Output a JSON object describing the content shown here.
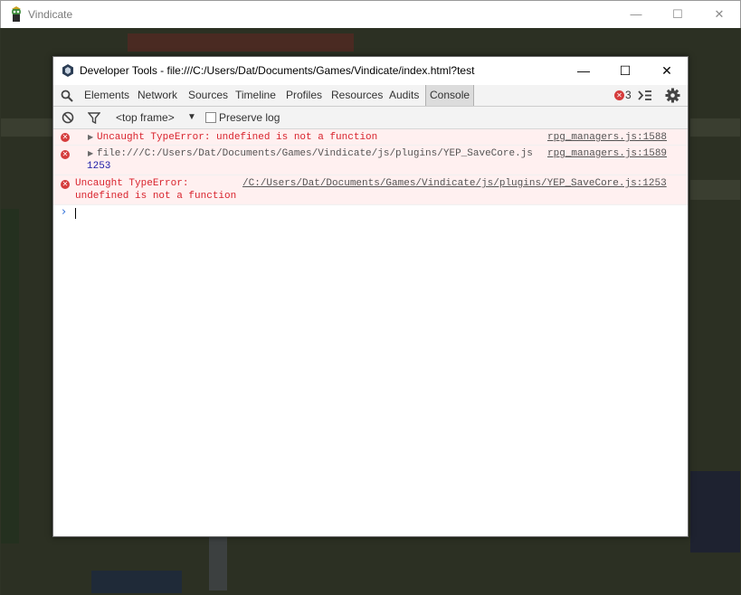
{
  "outer_window": {
    "title": "Vindicate",
    "minimize": "—",
    "maximize": "☐",
    "close": "✕"
  },
  "devtools": {
    "title": "Developer Tools - file:///C:/Users/Dat/Documents/Games/Vindicate/index.html?test",
    "controls": {
      "minimize": "—",
      "maximize": "☐",
      "close": "✕"
    },
    "tabs": [
      "Elements",
      "Network",
      "Sources",
      "Timeline",
      "Profiles",
      "Resources",
      "Audits",
      "Console"
    ],
    "active_tab": "Console",
    "error_count": "3",
    "toolbar": {
      "frame_selector": "<top frame>",
      "preserve_log_label": "Preserve log",
      "preserve_log_checked": false
    },
    "messages": [
      {
        "text": "Uncaught TypeError: undefined is not a function",
        "source": "rpg_managers.js:1588"
      },
      {
        "text": "file:///C:/Users/Dat/Documents/Games/Vindicate/js/plugins/YEP_SaveCore.js",
        "text2": "1253",
        "source": "rpg_managers.js:1589"
      },
      {
        "text": "Uncaught TypeError:",
        "text2": "undefined is not a function",
        "source": "/C:/Users/Dat/Documents/Games/Vindicate/js/plugins/YEP_SaveCore.js:1253"
      }
    ],
    "prompt": "›"
  },
  "colors": {
    "error": "#d8222c",
    "link": "#545454",
    "number": "#1a1aa6",
    "prompt": "#2e6fd8"
  }
}
